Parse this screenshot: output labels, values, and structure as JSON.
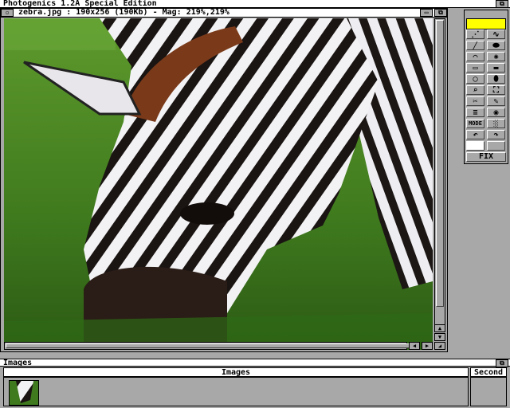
{
  "screen": {
    "title": "Photogenics 1.2A Special Edition"
  },
  "image_window": {
    "title": "zebra.jpg : 190x256 (190Kb) - Mag: 219%,219%"
  },
  "toolbox": {
    "color_swatch": "#ffff00",
    "tools": [
      "dotted-line",
      "freehand",
      "line",
      "filled-ellipse",
      "curve",
      "airbrush",
      "rectangle",
      "filled-rectangle",
      "ellipse",
      "filled-ellipse-2",
      "magnifier",
      "fit-window",
      "scissors",
      "pipette",
      "text",
      "sphere",
      "MODE",
      "dither",
      "undo",
      "redo",
      "white-swatch",
      "grey-swatch"
    ],
    "mode_label": "MODE",
    "fix_label": "FIX"
  },
  "images_panel": {
    "title": "Images",
    "column_images": "Images",
    "column_second": "Second"
  }
}
